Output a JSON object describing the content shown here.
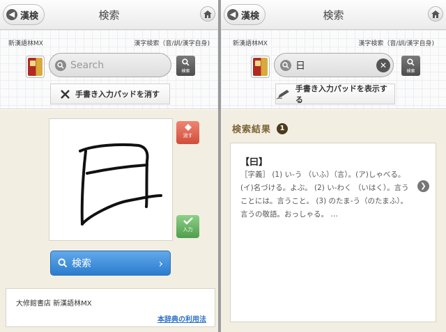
{
  "left": {
    "nav": {
      "back_label": "漢検",
      "title": "検索"
    },
    "dict_name": "新漢語林MX",
    "search_mode": "漢字検索（音/訓/漢字自身)",
    "search": {
      "placeholder": "Search",
      "value": ""
    },
    "search_button_label": "検索",
    "pad_toggle_label": "手書き入力パッドを消す",
    "erase_label": "消す",
    "enter_label": "入力",
    "big_search_label": "検索",
    "footer": {
      "publisher": "大修館書店 新漢語林MX",
      "terms_link": "本辞典の利用法"
    }
  },
  "right": {
    "nav": {
      "back_label": "漢検",
      "title": "検索"
    },
    "dict_name": "新漢語林MX",
    "search_mode": "漢字検索（音/訓/漢字自身)",
    "search": {
      "value": "日"
    },
    "search_button_label": "検索",
    "pad_toggle_label": "手書き入力パッドを表示する",
    "results": {
      "header": "検索結果",
      "count": "1",
      "entries": [
        {
          "headword": "【曰】",
          "definition": "［字義］ (1) い-う （いふ）（言）。(ア)しゃべる。(イ)名づける。よぶ。 (2) い-わく （いはく）。言うことには。言うこと。 (3) のたま-う（のたまふ）。言うの敬語。おっしゃる。 …"
        }
      ]
    }
  },
  "colors": {
    "accent_blue": "#2b7ccf",
    "erase_red": "#d14c3a",
    "enter_green": "#4f9e4a",
    "result_header": "#7a6235",
    "link": "#2a6fc4"
  },
  "icons": [
    "back-arrow-icon",
    "home-icon",
    "dictionary-book-icon",
    "search-icon",
    "clear-icon",
    "close-x-icon",
    "pencil-icon",
    "eraser-icon",
    "checkmark-icon",
    "chevron-right-icon"
  ]
}
